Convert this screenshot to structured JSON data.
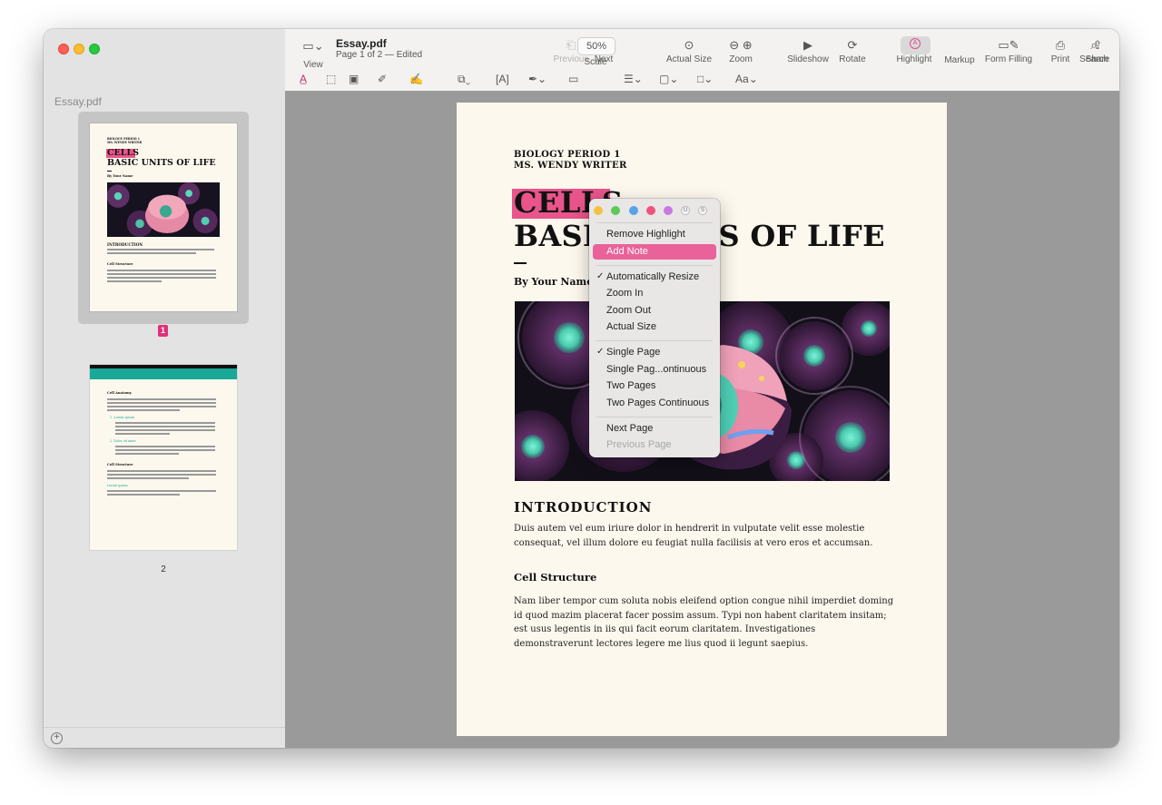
{
  "sidebar": {
    "title": "Essay.pdf",
    "page1_badge": "1",
    "page2_label": "2",
    "thumb1": {
      "header1": "BIOLOGY PERIOD 1",
      "header2": "MS. WENDY WRITER",
      "title1": "CELLS",
      "title2": "BASIC UNITS OF LIFE",
      "byline": "By Your Name",
      "intro": "INTRODUCTION",
      "cell_structure": "Cell Structure"
    },
    "thumb2": {
      "h1": "Cell Anatomy",
      "item1": "1.   Lorem ipsum",
      "item2": "2.   Dolor sit amet",
      "h2": "Cell Structure",
      "sub": "Lorem ipsum"
    }
  },
  "toolbar": {
    "view": "View",
    "doc_title": "Essay.pdf",
    "doc_sub": "Page 1 of 2 — Edited",
    "previous": "Previous",
    "next": "Next",
    "scale_value": "50%",
    "scale": "Scale",
    "actual_size": "Actual Size",
    "zoom": "Zoom",
    "slideshow": "Slideshow",
    "rotate": "Rotate",
    "highlight": "Highlight",
    "markup": "Markup",
    "form_filling": "Form Filling",
    "print": "Print",
    "share": "Share",
    "search": "Search",
    "text_size": "Aa"
  },
  "document": {
    "header_line1": "BIOLOGY PERIOD 1",
    "header_line2": "MS. WENDY WRITER",
    "title_highlight": "CELLS",
    "title_rest": "BASIC UNITS OF LIFE",
    "byline": "By Your Name",
    "intro_heading": "INTRODUCTION",
    "intro_text": "Duis autem vel eum iriure dolor in hendrerit in vulputate velit esse molestie consequat, vel illum dolore eu feugiat nulla facilisis at vero eros et accumsan.",
    "cell_heading": "Cell Structure",
    "cell_text": "Nam liber tempor cum soluta nobis eleifend option congue nihil imperdiet doming id quod mazim placerat facer possim assum. Typi non habent claritatem insitam; est usus legentis in iis qui facit eorum claritatem. Investigationes demonstraverunt lectores legere me lius quod ii legunt saepius."
  },
  "context_menu": {
    "colors": [
      "#f5c142",
      "#5cc95a",
      "#5aa2e8",
      "#ef5480",
      "#c97ae0"
    ],
    "underline_glyph": "U",
    "strike_glyph": "S",
    "remove_highlight": "Remove Highlight",
    "add_note": "Add Note",
    "auto_resize": "Automatically Resize",
    "zoom_in": "Zoom In",
    "zoom_out": "Zoom Out",
    "actual_size": "Actual Size",
    "single_page": "Single Page",
    "single_page_continuous": "Single Pag...ontinuous",
    "two_pages": "Two Pages",
    "two_pages_continuous": "Two Pages Continuous",
    "next_page": "Next Page",
    "previous_page": "Previous Page",
    "check": "✓"
  }
}
